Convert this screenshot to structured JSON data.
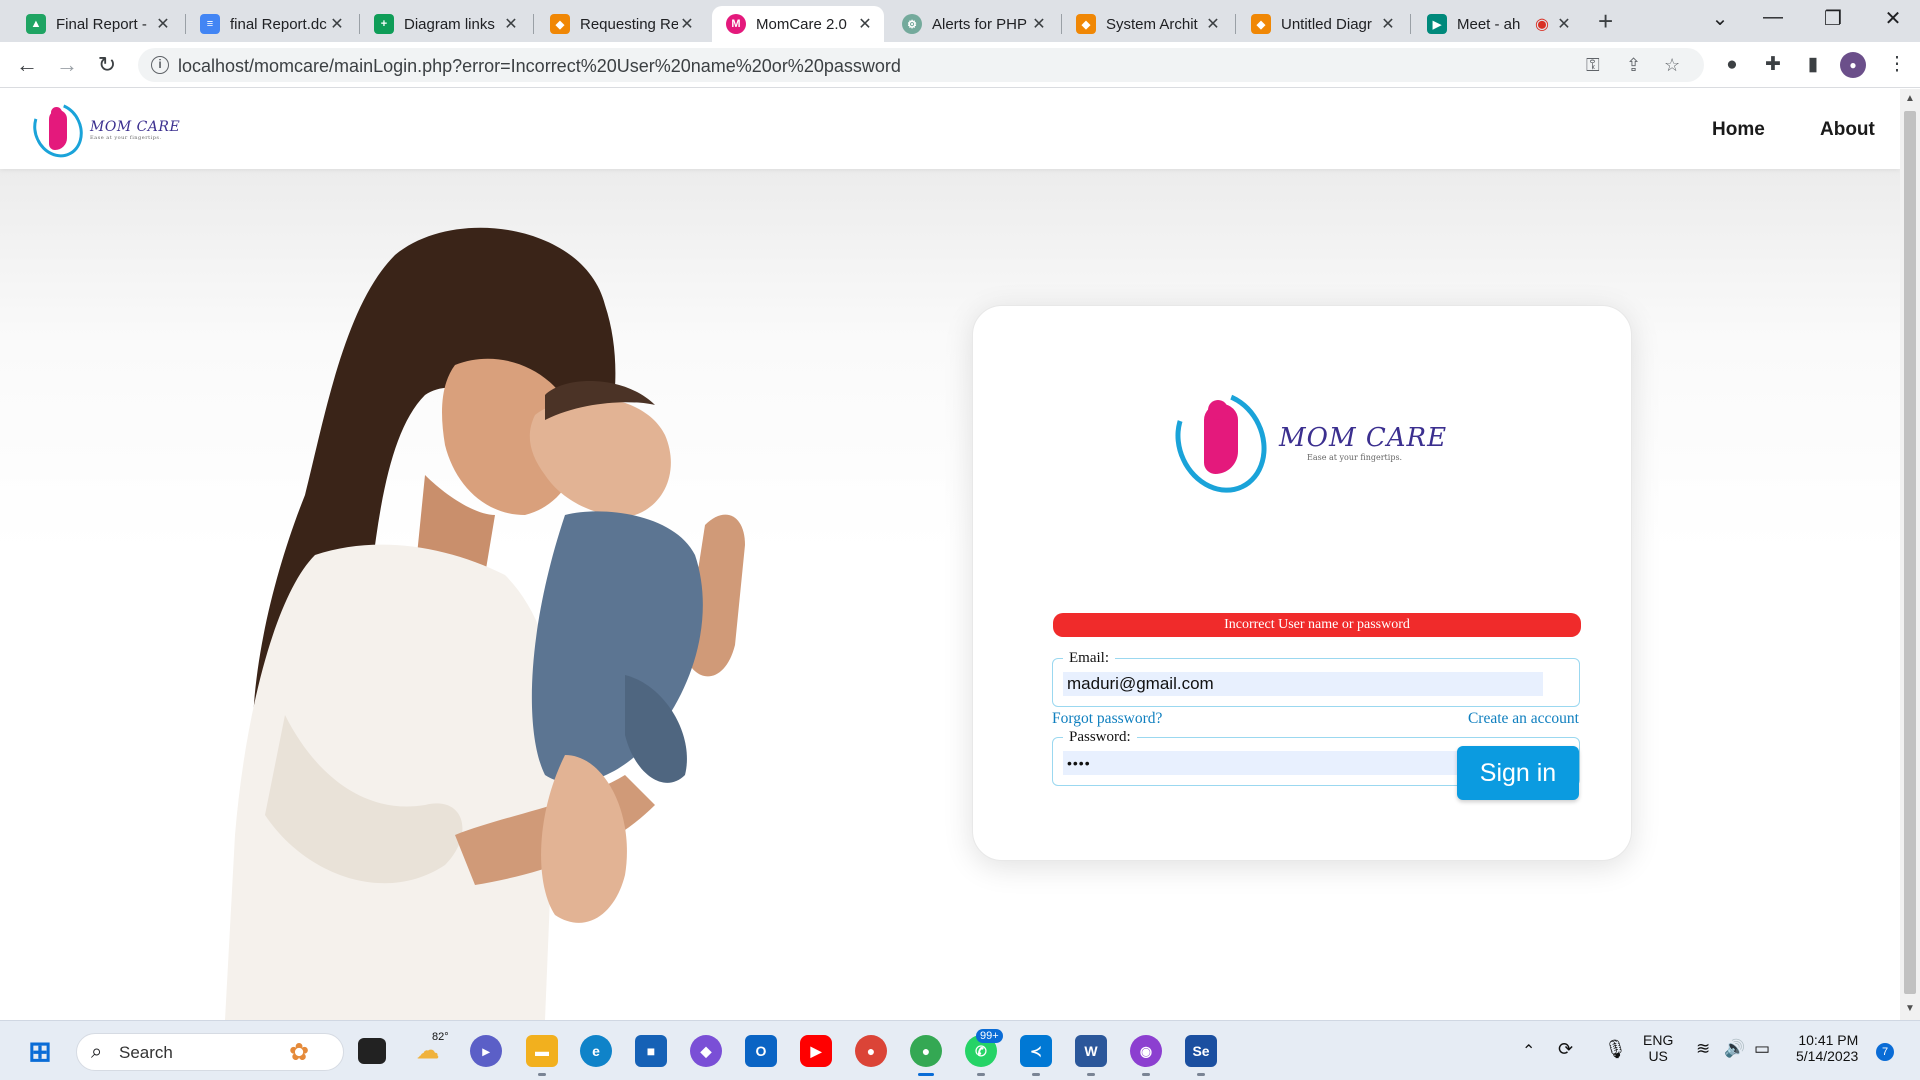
{
  "browser": {
    "tabs": [
      {
        "title": "Final Report -",
        "icon": "google-drive-icon",
        "color": "#1fa463"
      },
      {
        "title": "final Report.dc",
        "icon": "google-docs-icon",
        "color": "#4285f4"
      },
      {
        "title": "Diagram links",
        "icon": "google-sheets-icon",
        "color": "#0f9d58"
      },
      {
        "title": "Requesting Re",
        "icon": "drawio-icon",
        "color": "#f08705"
      },
      {
        "title": "MomCare 2.0",
        "icon": "momcare-favicon-icon",
        "color": "#e4197c"
      },
      {
        "title": "Alerts for PHP",
        "icon": "chatgpt-icon",
        "color": "#74aa9c"
      },
      {
        "title": "System Archit",
        "icon": "drawio-icon",
        "color": "#f08705"
      },
      {
        "title": "Untitled Diagr",
        "icon": "drawio-icon",
        "color": "#f08705"
      },
      {
        "title": "Meet - ah",
        "icon": "google-meet-icon",
        "color": "#00897b"
      }
    ],
    "url": "localhost/momcare/mainLogin.php?error=Incorrect%20User%20name%20or%20password"
  },
  "site": {
    "brand": "MOM CARE",
    "tagline": "Ease at your fingertips.",
    "nav": {
      "home": "Home",
      "about": "About"
    }
  },
  "login": {
    "error": "Incorrect User name or password",
    "email_label": "Email:",
    "email_value": "maduri@gmail.com",
    "password_label": "Password:",
    "password_value": "••••",
    "forgot": "Forgot password?",
    "create": "Create an account",
    "signin": "Sign in"
  },
  "taskbar": {
    "search": "Search",
    "weather": "82°",
    "whatsapp_badge": "99+",
    "lang_line1": "ENG",
    "lang_line2": "US",
    "time": "10:41 PM",
    "date": "5/14/2023",
    "notifications": "7"
  }
}
